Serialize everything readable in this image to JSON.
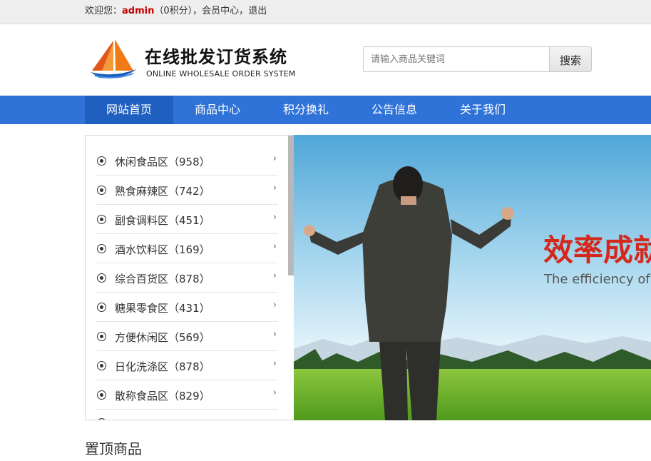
{
  "topbar": {
    "welcome": "欢迎您：",
    "username": "admin",
    "points": "（0积分）",
    "sep1": "，",
    "member_center": "会员中心",
    "sep2": "，",
    "logout": "退出"
  },
  "header": {
    "logo_title": "在线批发订货系统",
    "logo_subtitle": "ONLINE WHOLESALE ORDER SYSTEM",
    "search_placeholder": "请输入商品关键词",
    "search_button": "搜索"
  },
  "nav": {
    "items": [
      "网站首页",
      "商品中心",
      "积分换礼",
      "公告信息",
      "关于我们"
    ],
    "active_index": 0
  },
  "categories": [
    {
      "label": "休闲食品区（958）"
    },
    {
      "label": "熟食麻辣区（742）"
    },
    {
      "label": "副食调料区（451）"
    },
    {
      "label": "酒水饮料区（169）"
    },
    {
      "label": "综合百货区（878）"
    },
    {
      "label": "糖果零食区（431）"
    },
    {
      "label": "方便休闲区（569）"
    },
    {
      "label": "日化洗涤区（878）"
    },
    {
      "label": "散称食品区（829）"
    }
  ],
  "banner": {
    "headline": "效率成就",
    "tagline": "The efficiency of br"
  },
  "sections": {
    "top_products": "置顶商品"
  },
  "colors": {
    "nav_bg": "#2f73d8",
    "nav_active": "#1f5fc0",
    "username": "#c40000",
    "banner_headline": "#d4281b"
  },
  "icons": {
    "category_bullet": "radio-dot-icon",
    "category_arrow": "chevron-right-icon",
    "logo": "sailboat-icon"
  }
}
